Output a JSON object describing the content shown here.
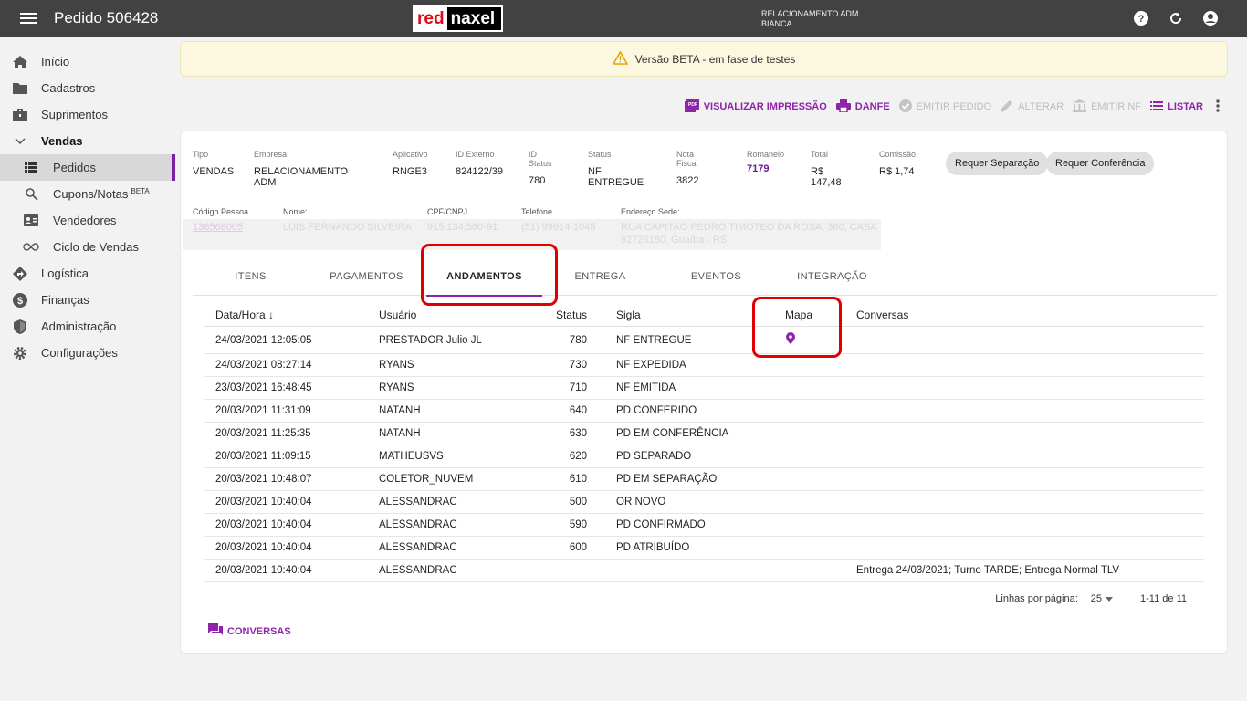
{
  "topbar": {
    "title": "Pedido 506428",
    "logo_red": "red",
    "logo_naxel": "naxel",
    "user_line1": "RELACIONAMENTO ADM",
    "user_line2": "BIANCA"
  },
  "sidebar": {
    "items": [
      {
        "label": "Início"
      },
      {
        "label": "Cadastros"
      },
      {
        "label": "Suprimentos"
      },
      {
        "label": "Vendas"
      },
      {
        "label": "Pedidos"
      },
      {
        "label": "Cupons/Notas",
        "sup": "BETA"
      },
      {
        "label": "Vendedores"
      },
      {
        "label": "Ciclo de Vendas"
      },
      {
        "label": "Logística"
      },
      {
        "label": "Finanças"
      },
      {
        "label": "Administração"
      },
      {
        "label": "Configurações"
      }
    ]
  },
  "banner": {
    "text": "Versão BETA - em fase de testes"
  },
  "actions": {
    "visualizar": "VISUALIZAR IMPRESSÃO",
    "danfe": "DANFE",
    "emitir_pedido": "EMITIR PEDIDO",
    "alterar": "ALTERAR",
    "emitir_nf": "EMITIR NF",
    "listar": "LISTAR"
  },
  "order": {
    "tipo_lbl": "Tipo",
    "tipo": "VENDAS",
    "empresa_lbl": "Empresa",
    "empresa": "RELACIONAMENTO ADM",
    "aplicativo_lbl": "Aplicativo",
    "aplicativo": "RNGE3",
    "idexterno_lbl": "ID Externo",
    "idexterno": "824122/39",
    "idstatus_lbl": "ID Status",
    "idstatus": "780",
    "status_lbl": "Status",
    "status": "NF ENTREGUE",
    "nf_lbl": "Nota Fiscal",
    "nf": "3822",
    "romaneio_lbl": "Romaneio",
    "romaneio": "7179",
    "total_lbl": "Total",
    "total": "R$ 147,48",
    "comissao_lbl": "Comissão",
    "comissao": "R$ 1,74",
    "chip1": "Requer Separação",
    "chip2": "Requer Conferência"
  },
  "person": {
    "codigo_lbl": "Código Pessoa",
    "codigo": "136568005",
    "nome_lbl": "Nome:",
    "nome": "LUIS FERNANDO SILVEIRA",
    "cpf_lbl": "CPF/CNPJ",
    "cpf": "915.134.560-91",
    "tel_lbl": "Telefone",
    "tel": "(51) 99914-1045",
    "end_lbl": "Endereço Sede:",
    "end1": "RUA CAPITAO PEDRO TIMOTEO DA ROSA, 360, CASA",
    "end2": "92726180, Guaíba - RS"
  },
  "tabs": [
    "ITENS",
    "PAGAMENTOS",
    "ANDAMENTOS",
    "ENTREGA",
    "EVENTOS",
    "INTEGRAÇÃO"
  ],
  "table": {
    "headers": {
      "date": "Data/Hora",
      "user": "Usuário",
      "status": "Status",
      "sigla": "Sigla",
      "mapa": "Mapa",
      "conv": "Conversas"
    },
    "rows": [
      {
        "date": "24/03/2021 12:05:05",
        "user": "PRESTADOR Julio JL",
        "status": "780",
        "sigla": "NF ENTREGUE",
        "conv": ""
      },
      {
        "date": "24/03/2021 08:27:14",
        "user": "RYANS",
        "status": "730",
        "sigla": "NF EXPEDIDA",
        "conv": ""
      },
      {
        "date": "23/03/2021 16:48:45",
        "user": "RYANS",
        "status": "710",
        "sigla": "NF EMITIDA",
        "conv": ""
      },
      {
        "date": "20/03/2021 11:31:09",
        "user": "NATANH",
        "status": "640",
        "sigla": "PD CONFERIDO",
        "conv": ""
      },
      {
        "date": "20/03/2021 11:25:35",
        "user": "NATANH",
        "status": "630",
        "sigla": "PD EM CONFERÊNCIA",
        "conv": ""
      },
      {
        "date": "20/03/2021 11:09:15",
        "user": "MATHEUSVS",
        "status": "620",
        "sigla": "PD SEPARADO",
        "conv": ""
      },
      {
        "date": "20/03/2021 10:48:07",
        "user": "COLETOR_NUVEM",
        "status": "610",
        "sigla": "PD EM SEPARAÇÃO",
        "conv": ""
      },
      {
        "date": "20/03/2021 10:40:04",
        "user": "ALESSANDRAC",
        "status": "500",
        "sigla": "OR NOVO",
        "conv": ""
      },
      {
        "date": "20/03/2021 10:40:04",
        "user": "ALESSANDRAC",
        "status": "590",
        "sigla": "PD CONFIRMADO",
        "conv": ""
      },
      {
        "date": "20/03/2021 10:40:04",
        "user": "ALESSANDRAC",
        "status": "600",
        "sigla": "PD ATRIBUÍDO",
        "conv": ""
      },
      {
        "date": "20/03/2021 10:40:04",
        "user": "ALESSANDRAC",
        "status": "",
        "sigla": "",
        "conv": "Entrega 24/03/2021; Turno TARDE; Entrega Normal TLV"
      }
    ]
  },
  "pager": {
    "label": "Linhas por página:",
    "value": "25",
    "range": "1-11 de 11"
  },
  "conversas_button": "CONVERSAS",
  "colors": {
    "accent": "#8e24aa",
    "topbar": "#424242",
    "highlight": "#e00000"
  }
}
